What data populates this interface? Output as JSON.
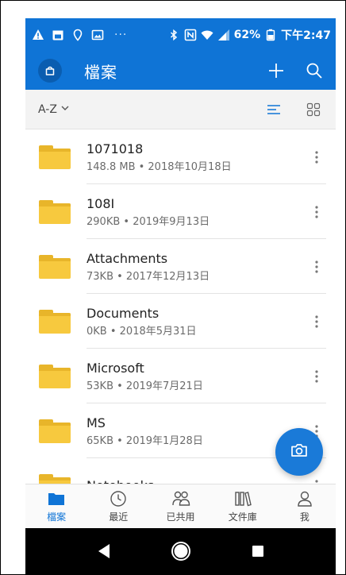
{
  "status_bar": {
    "battery": "62%",
    "time": "下午2:47",
    "ellipsis": "···",
    "icons": [
      "warning-icon",
      "calendar-icon",
      "location-icon",
      "image-icon",
      "bluetooth-icon",
      "nfc-icon",
      "wifi-icon",
      "signal-icon",
      "battery-icon"
    ]
  },
  "app_bar": {
    "title": "檔案",
    "icons": [
      "account-icon",
      "add-icon",
      "search-icon"
    ]
  },
  "sort_bar": {
    "sort_label": "A-Z",
    "icons": [
      "chevron-down-icon",
      "list-view-icon",
      "grid-view-icon"
    ]
  },
  "files": [
    {
      "name": "1071018",
      "meta": "148.8 MB • 2018年10月18日"
    },
    {
      "name": "108I",
      "meta": "290KB • 2019年9月13日"
    },
    {
      "name": "Attachments",
      "meta": "73KB • 2017年12月13日"
    },
    {
      "name": "Documents",
      "meta": "0KB • 2018年5月31日"
    },
    {
      "name": "Microsoft",
      "meta": "53KB • 2019年7月21日"
    },
    {
      "name": "MS",
      "meta": "65KB • 2019年1月28日"
    },
    {
      "name": "Notebooks",
      "meta": ""
    }
  ],
  "fab": {
    "icon": "camera-icon"
  },
  "bottom_nav": {
    "items": [
      {
        "label": "檔案",
        "icon": "folder-icon",
        "active": true
      },
      {
        "label": "最近",
        "icon": "clock-icon",
        "active": false
      },
      {
        "label": "已共用",
        "icon": "shared-icon",
        "active": false
      },
      {
        "label": "文件庫",
        "icon": "library-icon",
        "active": false
      },
      {
        "label": "我",
        "icon": "person-icon",
        "active": false
      }
    ]
  },
  "colors": {
    "accent": "#0f74d6",
    "folder": "#f7c93e",
    "fab": "#1a7ad8"
  }
}
